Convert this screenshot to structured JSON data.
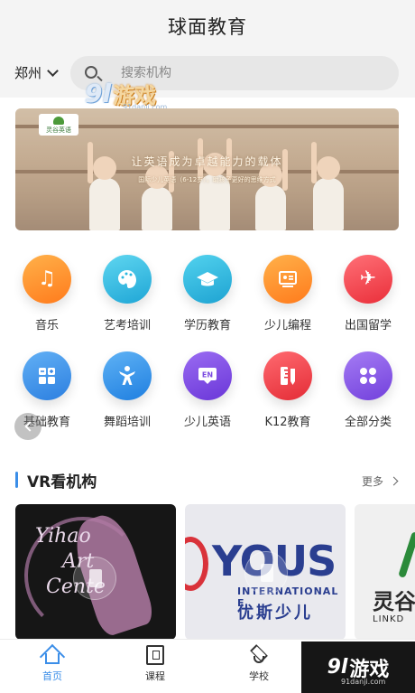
{
  "header": {
    "title": "球面教育"
  },
  "search": {
    "city": "郑州",
    "placeholder": "搜索机构"
  },
  "watermark": {
    "logo": "9l",
    "text": "游戏",
    "url": "91danji.com"
  },
  "banner": {
    "logo_text": "灵谷英语",
    "headline": "让英语成为卓越能力的载体",
    "subline": "国际少儿英语（6-12岁），助孩子更好的思维方式"
  },
  "categories": [
    {
      "label": "音乐",
      "icon": "music-note-icon",
      "color": "#ff8a2a"
    },
    {
      "label": "艺考培训",
      "icon": "palette-icon",
      "color": "#2ab8e0"
    },
    {
      "label": "学历教育",
      "icon": "graduation-cap-icon",
      "color": "#26b4d8"
    },
    {
      "label": "少儿编程",
      "icon": "presentation-icon",
      "color": "#ff8a2a"
    },
    {
      "label": "出国留学",
      "icon": "airplane-icon",
      "color": "#f2454f"
    },
    {
      "label": "基础教育",
      "icon": "calculator-icon",
      "color": "#3b8ee8"
    },
    {
      "label": "舞蹈培训",
      "icon": "dancer-icon",
      "color": "#2c8de6"
    },
    {
      "label": "少儿英语",
      "icon": "en-book-icon",
      "color": "#7b4be0"
    },
    {
      "label": "K12教育",
      "icon": "ruler-pencil-icon",
      "color": "#f0434b"
    },
    {
      "label": "全部分类",
      "icon": "grid-icon",
      "color": "#8a5be8"
    }
  ],
  "section": {
    "title": "VR看机构",
    "more": "更多"
  },
  "cards": [
    {
      "brand_line1": "Yihao",
      "brand_line2": "Art",
      "brand_line3": "Cente"
    },
    {
      "brand": "YOUS",
      "intl": "INTERNATIONAL E",
      "cn": "优斯少儿"
    },
    {
      "cn": "灵谷",
      "en": "LINKD"
    }
  ],
  "tabbar": [
    {
      "label": "首页",
      "icon": "home-icon",
      "active": true
    },
    {
      "label": "课程",
      "icon": "book-icon",
      "active": false
    },
    {
      "label": "学校",
      "icon": "school-cap-icon",
      "active": false
    }
  ],
  "colors": {
    "accent": "#3b8ee8",
    "header_bg": "#f4f4f4"
  }
}
